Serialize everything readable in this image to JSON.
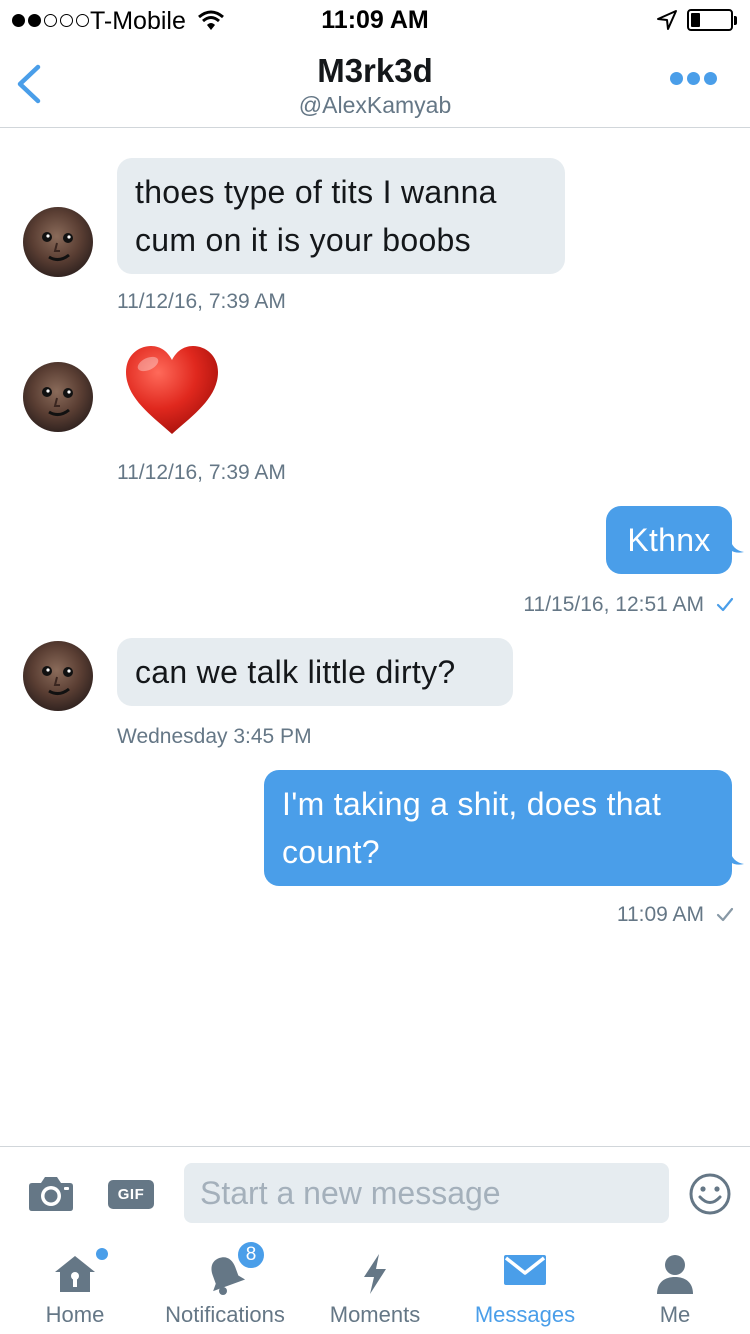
{
  "status_bar": {
    "carrier": "T-Mobile",
    "time": "11:09 AM",
    "signal_bars_filled": 2,
    "signal_bars_total": 5,
    "battery_level": 0.2
  },
  "header": {
    "title": "M3rk3d",
    "handle": "@AlexKamyab"
  },
  "messages": [
    {
      "direction": "incoming",
      "text": "thoes type of tits I wanna cum on it is your boobs",
      "timestamp": "11/12/16, 7:39 AM"
    },
    {
      "direction": "incoming",
      "emoji": "red-heart",
      "timestamp": "11/12/16, 7:39 AM"
    },
    {
      "direction": "outgoing",
      "text": "Kthnx",
      "timestamp": "11/15/16, 12:51 AM",
      "read": true
    },
    {
      "direction": "incoming",
      "text": "can we talk little dirty?",
      "timestamp": "Wednesday 3:45 PM"
    },
    {
      "direction": "outgoing",
      "text": "I'm taking a shit, does that count?",
      "timestamp": "11:09 AM",
      "read": false
    }
  ],
  "composer": {
    "gif_label": "GIF",
    "placeholder": "Start a new message"
  },
  "tabs": [
    {
      "label": "Home",
      "icon": "home-icon",
      "active": false,
      "unread_dot": true
    },
    {
      "label": "Notifications",
      "icon": "bell-icon",
      "active": false,
      "badge": "8"
    },
    {
      "label": "Moments",
      "icon": "lightning-icon",
      "active": false
    },
    {
      "label": "Messages",
      "icon": "envelope-icon",
      "active": true
    },
    {
      "label": "Me",
      "icon": "person-icon",
      "active": false
    }
  ],
  "colors": {
    "accent": "#4a9ee9",
    "incoming_bubble": "#e6ecf0",
    "secondary_text": "#657786"
  }
}
